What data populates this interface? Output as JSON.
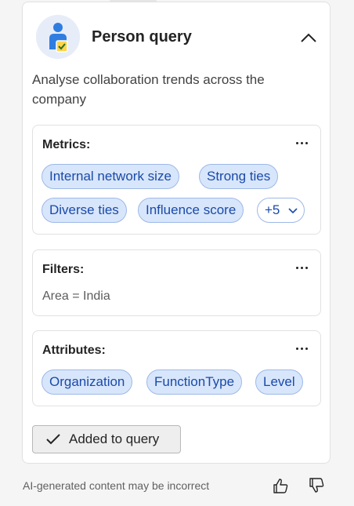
{
  "card": {
    "title": "Person query",
    "description": "Analyse collaboration trends across the company"
  },
  "metrics": {
    "label": "Metrics:",
    "items": [
      "Internal network size",
      "Strong ties",
      "Diverse ties",
      "Influence score"
    ],
    "more_label": "+5"
  },
  "filters": {
    "label": "Filters:",
    "value": "Area = India"
  },
  "attributes": {
    "label": "Attributes:",
    "items": [
      "Organization",
      "FunctionType",
      "Level"
    ]
  },
  "action": {
    "added_label": "Added to query"
  },
  "footer": {
    "disclaimer": "AI-generated content may be incorrect"
  },
  "icons": {
    "avatar": "person-query-icon",
    "collapse": "chevron-up-icon",
    "more": "more-horizontal-icon",
    "expand": "chevron-down-icon",
    "check": "checkmark-icon",
    "like": "thumbs-up-icon",
    "dislike": "thumbs-down-icon"
  },
  "colors": {
    "pill_background": "#d8e6fb",
    "pill_border": "#9db8e8",
    "pill_text": "#1a4aa8"
  }
}
